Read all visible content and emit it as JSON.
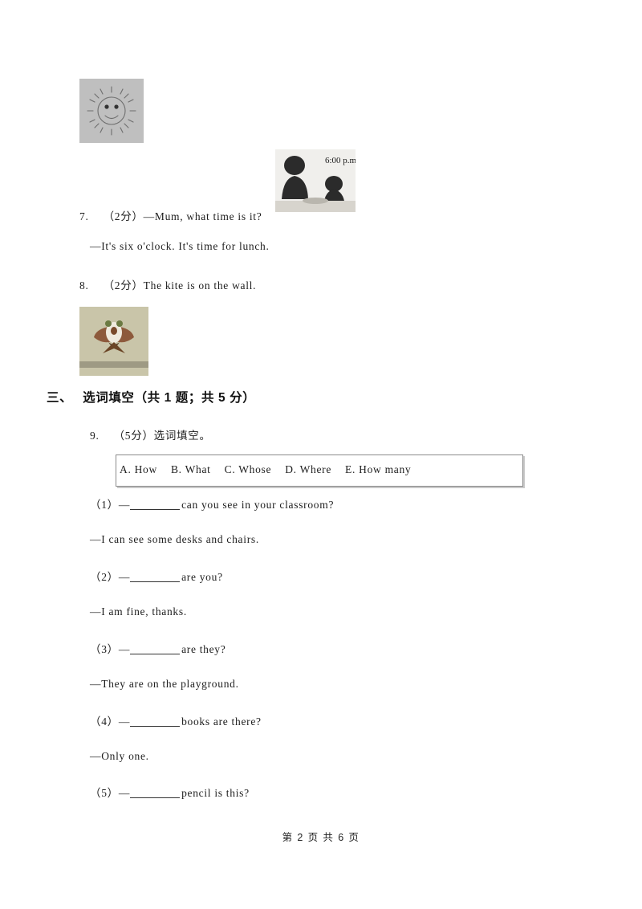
{
  "document": {
    "images": [
      {
        "name": "sun-drawing",
        "alt": "smiling sun drawing"
      },
      {
        "name": "dinner-clock-photo",
        "alt": "two silhouettes at table",
        "time_label": "6:00 p.m."
      },
      {
        "name": "kite-photo",
        "alt": "kite on a wall"
      }
    ],
    "questions": [
      {
        "number": "7.",
        "score": "（2分）",
        "text": "—Mum, what time is it?"
      },
      {
        "continuation": "—It's six o'clock. It's time for lunch."
      },
      {
        "number": "8.",
        "score": "（2分）",
        "text": "The kite is on the wall."
      }
    ],
    "section": {
      "index": "三、",
      "title": "选词填空",
      "meta": "（共 1 题；共 5 分）"
    },
    "question9": {
      "number": "9.",
      "score": "（5分）",
      "prompt": "选词填空。",
      "options": [
        "A. How",
        "B. What",
        "C. Whose",
        "D. Where",
        "E. How many"
      ],
      "items": [
        {
          "label": "（1）",
          "dash": "—",
          "after_blank": "can you see in your classroom?",
          "answer": "—I can see some desks and chairs."
        },
        {
          "label": "（2）",
          "dash": "—",
          "after_blank": "are you?",
          "answer": "—I am fine, thanks."
        },
        {
          "label": "（3）",
          "dash": "—",
          "after_blank": "are they?",
          "answer": "—They are on the playground."
        },
        {
          "label": "（4）",
          "dash": "—",
          "after_blank": "books are there?",
          "answer": "—Only one."
        },
        {
          "label": "（5）",
          "dash": "—",
          "after_blank": "pencil is this?",
          "answer": ""
        }
      ]
    },
    "footer": "第 2 页 共 6 页",
    "colors": {
      "sun_bg": "#bfbfbf",
      "kite_bg": "#c9c5a9",
      "box_border": "#8c8c8c",
      "text": "#1d1d1d"
    }
  }
}
